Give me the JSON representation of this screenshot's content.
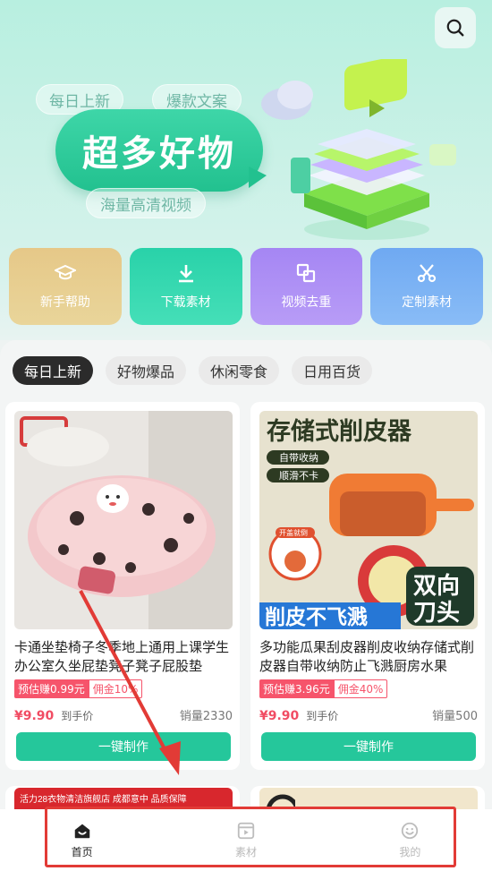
{
  "banner": {
    "pill_daily": "每日上新",
    "pill_hot_copy": "爆款文案",
    "headline": "超多好物",
    "pill_hd_video": "海量高清视频"
  },
  "quick_actions": [
    {
      "label": "新手帮助",
      "icon": "graduation-cap-icon",
      "color": "#e6c888"
    },
    {
      "label": "下载素材",
      "icon": "download-icon",
      "color": "#29d2a9"
    },
    {
      "label": "视频去重",
      "icon": "duplicate-icon",
      "color": "#a586f3"
    },
    {
      "label": "定制素材",
      "icon": "scissors-icon",
      "color": "#6fa9f2"
    }
  ],
  "tabs": [
    "每日上新",
    "好物爆品",
    "休闲零食",
    "日用百货"
  ],
  "products": [
    {
      "title": "卡通坐垫椅子冬季地上通用上课学生办公室久坐屁垫凳子凳子屁股垫",
      "estimate": "预估赚0.99元",
      "commission": "佣金10%",
      "price": "¥9.90",
      "price_label": "到手价",
      "sales": "销量2330",
      "button": "一键制作"
    },
    {
      "title": "多功能瓜果刮皮器削皮收纳存储式削皮器自带收纳防止飞溅厨房水果",
      "estimate": "预估赚3.96元",
      "commission": "佣金40%",
      "price": "¥9.90",
      "price_label": "到手价",
      "sales": "销量500",
      "button": "一键制作",
      "image_text": {
        "headline": "存储式削皮器",
        "tag1": "自带收纳",
        "tag2": "顺滑不卡",
        "small_tag": "开盖就倒",
        "bottom_left": "削皮不飞溅",
        "bottom_right_1": "双向",
        "bottom_right_2": "刀头"
      }
    }
  ],
  "peek_text": "活力28衣物清洁旗舰店 成都意中 品质保障",
  "bottom_nav": [
    {
      "label": "首页",
      "icon": "home-icon",
      "active": true
    },
    {
      "label": "素材",
      "icon": "video-library-icon",
      "active": false
    },
    {
      "label": "我的",
      "icon": "smiley-icon",
      "active": false
    }
  ],
  "colors": {
    "accent": "#25c79b",
    "price": "#f14c63",
    "annotation": "#e23b36"
  }
}
